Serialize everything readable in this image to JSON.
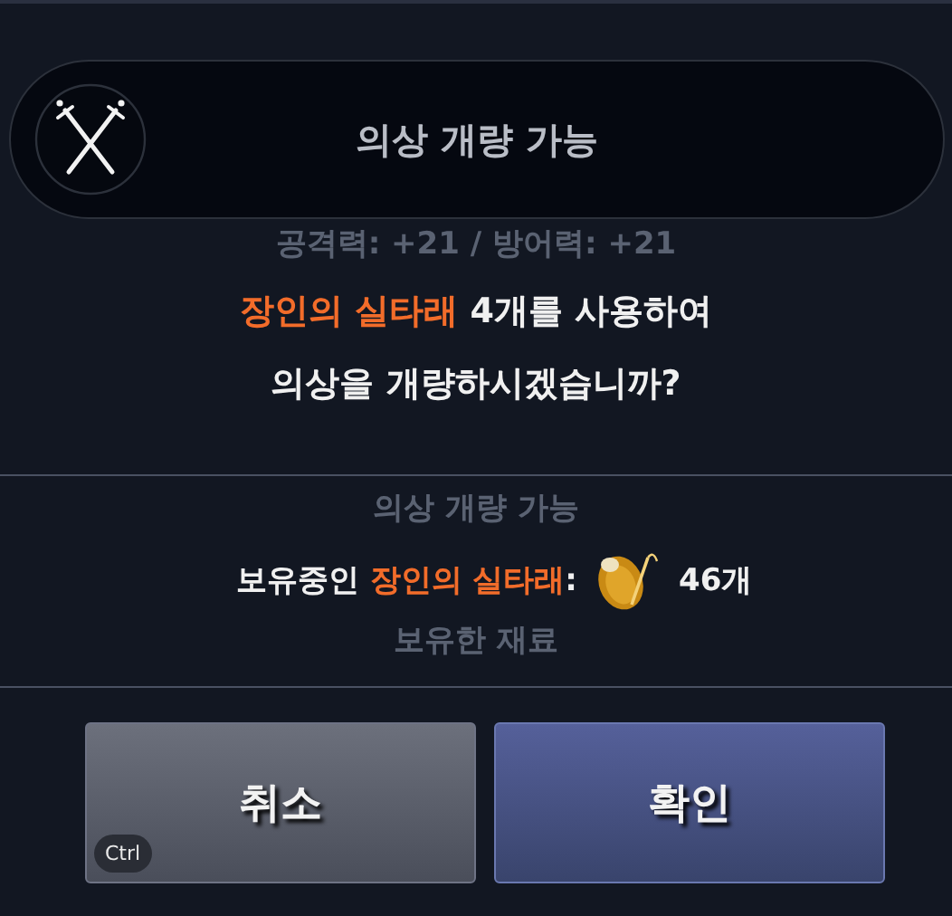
{
  "dialog": {
    "title": "의상 개량 가능",
    "background_texts": [
      {
        "text": "공격력: +21 / 방어력: +21"
      },
      {
        "text": "의상 개량 가능"
      },
      {
        "text": "보유한 재료"
      }
    ],
    "message": "**장인의 실타래** 4개를 사용하여\n의상을 개량하시겠습니까?",
    "owned": {
      "label": "보유중인",
      "item": "장인의 실타래",
      "colon": ":",
      "count": "46개"
    },
    "buttons": [
      {
        "label": "취소",
        "kind": "cancel",
        "shortcut": "Ctrl"
      },
      {
        "label": "확인",
        "kind": "confirm"
      }
    ]
  }
}
